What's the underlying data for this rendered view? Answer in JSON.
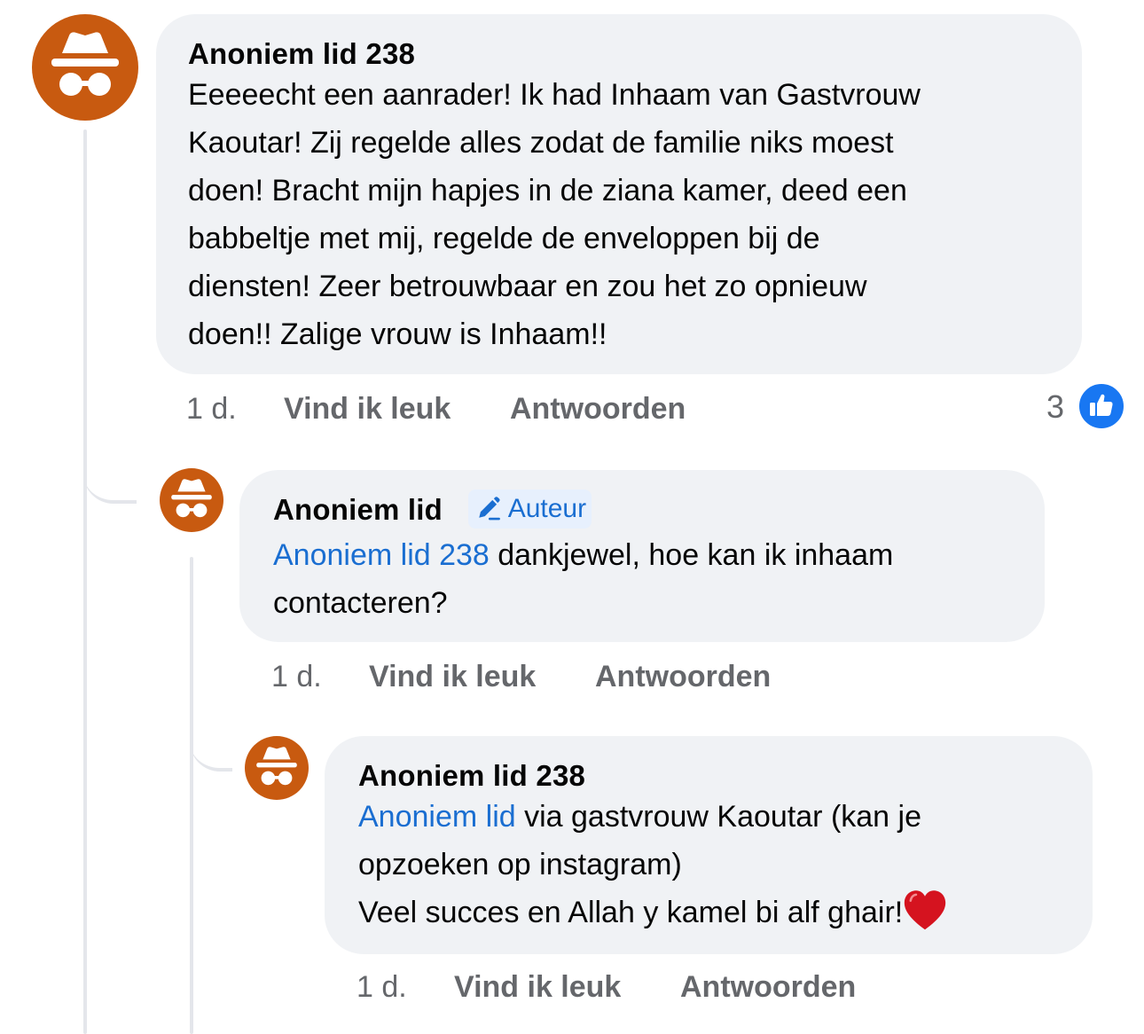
{
  "comments": [
    {
      "author": "Anoniem lid 238",
      "lines": [
        "Eeeeecht een aanrader! Ik had Inhaam van Gastvrouw",
        "Kaoutar! Zij regelde alles zodat de familie niks moest",
        "doen! Bracht mijn hapjes in de ziana kamer, deed een",
        "babbeltje met mij, regelde de enveloppen bij de",
        "diensten! Zeer betrouwbaar en zou het zo opnieuw",
        "doen!! Zalige vrouw is Inhaam!!"
      ],
      "time": "1 d.",
      "like_label": "Vind ik leuk",
      "reply_label": "Antwoorden",
      "reaction_count": "3"
    },
    {
      "author": "Anoniem lid",
      "badge": "Auteur",
      "mention": "Anoniem lid 238",
      "line1_rest": " dankjewel, hoe kan ik inhaam",
      "line2": "contacteren?",
      "time": "1 d.",
      "like_label": "Vind ik leuk",
      "reply_label": "Antwoorden"
    },
    {
      "author": "Anoniem lid 238",
      "mention": "Anoniem lid",
      "line1_rest": " via gastvrouw Kaoutar (kan je",
      "line2": "opzoeken op instagram)",
      "line3": "Veel succes en Allah y kamel bi alf ghair!",
      "time": "1 d.",
      "like_label": "Vind ik leuk",
      "reply_label": "Antwoorden"
    }
  ],
  "icons": {
    "avatar": "anonymous-incognito-icon",
    "badge": "pencil-icon",
    "reaction": "thumbs-up-icon",
    "emoji": "red-heart-icon"
  },
  "colors": {
    "avatar": "#c85a10",
    "bubble": "#f0f2f5",
    "mention": "#1a6ed1",
    "like": "#1877f2",
    "heart": "#d5131f"
  }
}
